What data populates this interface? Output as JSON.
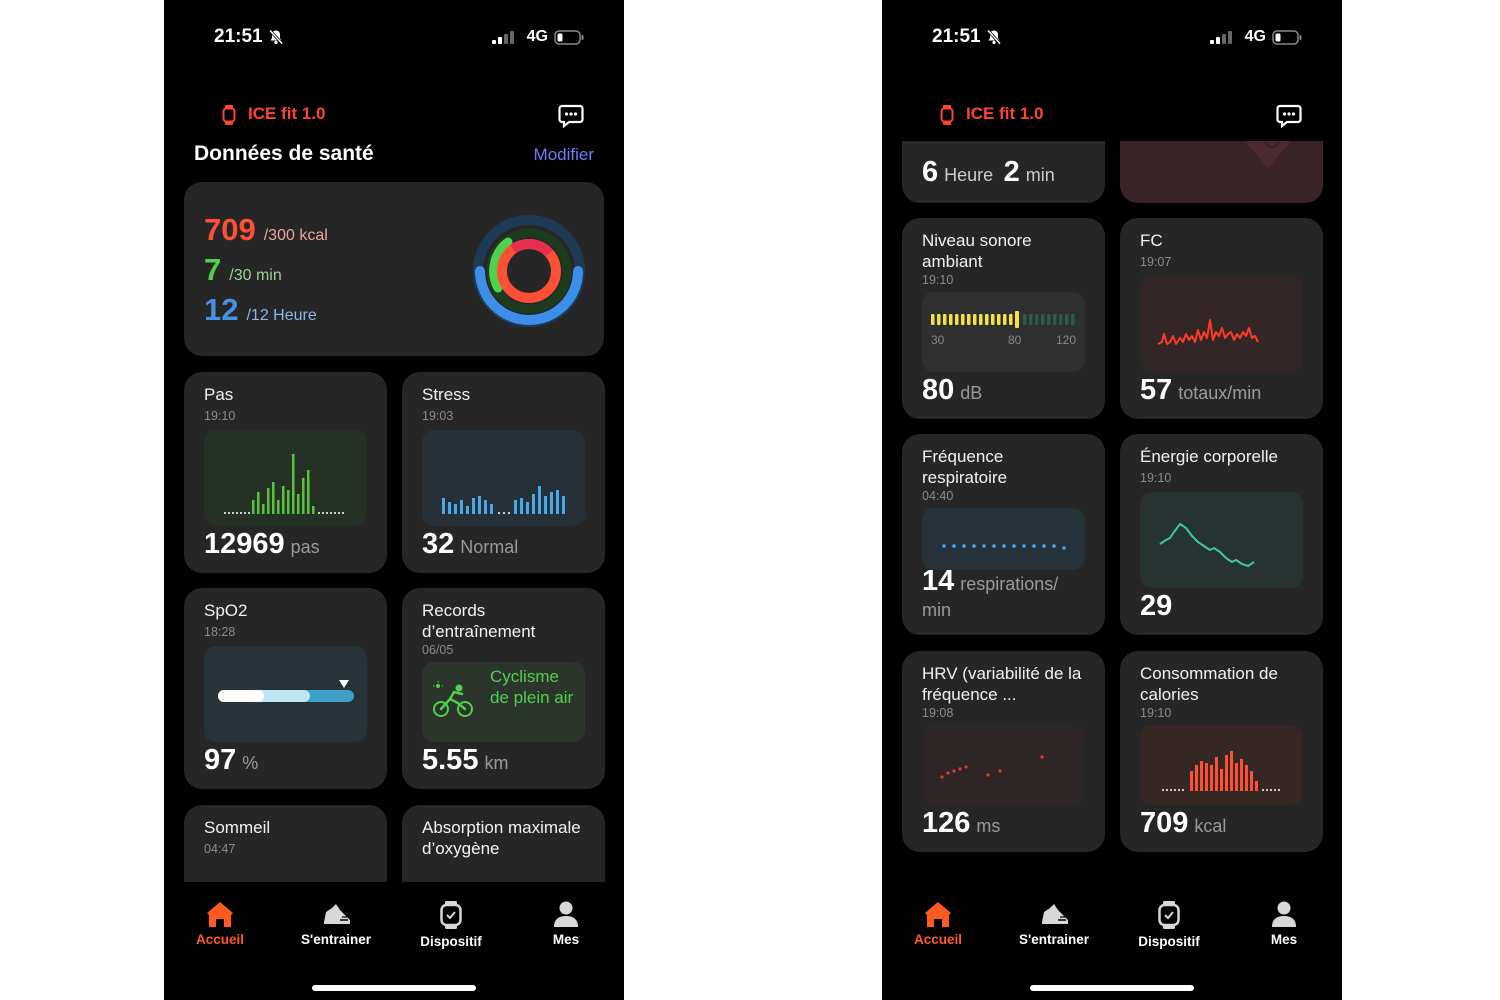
{
  "status_bar": {
    "time": "21:51",
    "network": "4G"
  },
  "app": {
    "device_name": "ICE fit 1.0"
  },
  "colors": {
    "accent": "#ff5a1f",
    "calories": "#ff4f35",
    "exercise": "#4fd04f",
    "standing": "#4a90e2",
    "link": "#6e7cf7",
    "steps": "#58c23c",
    "stress": "#4aa8e8"
  },
  "left_screen": {
    "title": "Données de santé",
    "edit_label": "Modifier",
    "summary": {
      "calories": {
        "value": "709",
        "goal": "/300 kcal"
      },
      "exercise": {
        "value": "7",
        "goal": "/30 min"
      },
      "standing": {
        "value": "12",
        "goal": "/12 Heure"
      }
    },
    "steps": {
      "title": "Pas",
      "time": "19:10",
      "value": "12969",
      "unit": "pas"
    },
    "stress": {
      "title": "Stress",
      "time": "19:03",
      "value": "32",
      "unit": "Normal"
    },
    "spo2": {
      "title": "SpO2",
      "time": "18:28",
      "value": "97",
      "unit": "%"
    },
    "training": {
      "title": "Records d’entraînement",
      "time": "06/05",
      "activity": "Cyclisme de plein air",
      "value": "5.55",
      "unit": "km"
    },
    "sleep": {
      "title": "Sommeil",
      "time": "04:47"
    },
    "vo2max": {
      "title": "Absorption maximale d’oxygène"
    }
  },
  "right_screen": {
    "sleep_partial": {
      "hours": "6",
      "hours_unit": "Heure",
      "minutes": "2",
      "minutes_unit": "min"
    },
    "noise": {
      "title": "Niveau sonore ambiant",
      "time": "19:10",
      "scale": [
        "30",
        "80",
        "120"
      ],
      "value": "80",
      "unit": "dB"
    },
    "heart_rate": {
      "title": "FC",
      "time": "19:07",
      "value": "57",
      "unit": "totaux/min"
    },
    "respiration": {
      "title": "Fréquence respiratoire",
      "time": "04:40",
      "value": "14",
      "unit": "respirations/",
      "unit_line2": "min"
    },
    "body_energy": {
      "title": "Énergie corporelle",
      "time": "19:10",
      "value": "29"
    },
    "hrv": {
      "title": "HRV (variabilité de la fréquence ...",
      "time": "19:08",
      "value": "126",
      "unit": "ms"
    },
    "calories": {
      "title": "Consommation de calories",
      "time": "19:10",
      "value": "709",
      "unit": "kcal"
    }
  },
  "nav": {
    "items": [
      {
        "label": "Accueil",
        "icon": "home-icon",
        "active": true
      },
      {
        "label": "S'entrainer",
        "icon": "sneaker-icon",
        "active": false
      },
      {
        "label": "Dispositif",
        "icon": "watch-icon",
        "active": false
      },
      {
        "label": "Mes",
        "icon": "person-icon",
        "active": false
      }
    ]
  }
}
